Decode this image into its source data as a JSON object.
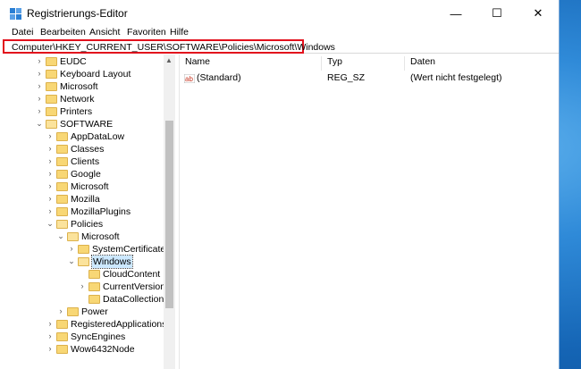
{
  "window": {
    "title": "Registrierungs-Editor",
    "controls": {
      "minimize": "—",
      "maximize": "☐",
      "close": "✕"
    }
  },
  "menu": [
    "Datei",
    "Bearbeiten",
    "Ansicht",
    "Favoriten",
    "Hilfe"
  ],
  "address": "Computer\\HKEY_CURRENT_USER\\SOFTWARE\\Policies\\Microsoft\\Windows",
  "tree": [
    {
      "label": "EUDC",
      "expander": "›"
    },
    {
      "label": "Keyboard Layout",
      "expander": "›"
    },
    {
      "label": "Microsoft",
      "expander": "›"
    },
    {
      "label": "Network",
      "expander": "›"
    },
    {
      "label": "Printers",
      "expander": "›"
    },
    {
      "label": "SOFTWARE",
      "expander": "⌄"
    },
    {
      "label": "AppDataLow",
      "expander": "›"
    },
    {
      "label": "Classes",
      "expander": "›"
    },
    {
      "label": "Clients",
      "expander": "›"
    },
    {
      "label": "Google",
      "expander": "›"
    },
    {
      "label": "Microsoft",
      "expander": "›"
    },
    {
      "label": "Mozilla",
      "expander": "›"
    },
    {
      "label": "MozillaPlugins",
      "expander": "›"
    },
    {
      "label": "Policies",
      "expander": "⌄"
    },
    {
      "label": "Microsoft",
      "expander": "⌄"
    },
    {
      "label": "SystemCertificates",
      "expander": "›"
    },
    {
      "label": "Windows",
      "expander": "⌄",
      "selected": true
    },
    {
      "label": "CloudContent",
      "expander": ""
    },
    {
      "label": "CurrentVersion",
      "expander": "›"
    },
    {
      "label": "DataCollection",
      "expander": ""
    },
    {
      "label": "Power",
      "expander": "›"
    },
    {
      "label": "RegisteredApplications",
      "expander": "›"
    },
    {
      "label": "SyncEngines",
      "expander": "›"
    },
    {
      "label": "Wow6432Node",
      "expander": "›"
    }
  ],
  "list": {
    "columns": [
      "Name",
      "Typ",
      "Daten"
    ],
    "rows": [
      {
        "name": "(Standard)",
        "type": "REG_SZ",
        "data": "(Wert nicht festgelegt)",
        "icon": "ab"
      }
    ]
  },
  "colors": {
    "highlight": "#e2101c",
    "selection": "#cce8ff",
    "folder": "#f8d775"
  }
}
